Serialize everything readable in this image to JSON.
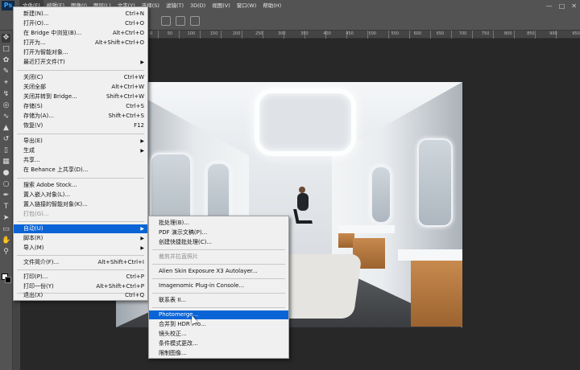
{
  "menubar": {
    "logo": "Ps",
    "items": [
      "文件(F)",
      "编辑(E)",
      "图像(I)",
      "图层(L)",
      "文字(Y)",
      "选择(S)",
      "滤镜(T)",
      "3D(D)",
      "视图(V)",
      "窗口(W)",
      "帮助(H)"
    ]
  },
  "ruler": {
    "numbers": [
      "0",
      "50",
      "100",
      "150",
      "200",
      "250",
      "300",
      "350",
      "400",
      "450",
      "500",
      "550",
      "600",
      "650",
      "700",
      "750",
      "800",
      "850",
      "900",
      "950"
    ]
  },
  "file_menu": {
    "items": [
      {
        "label": "新建(N)...",
        "shortcut": "Ctrl+N"
      },
      {
        "label": "打开(O)...",
        "shortcut": "Ctrl+O"
      },
      {
        "label": "在 Bridge 中浏览(B)...",
        "shortcut": "Alt+Ctrl+O"
      },
      {
        "label": "打开为...",
        "shortcut": "Alt+Shift+Ctrl+O"
      },
      {
        "label": "打开为智能对象...",
        "shortcut": ""
      },
      {
        "label": "最近打开文件(T)",
        "shortcut": "",
        "submenu": true
      },
      {
        "label": "关闭(C)",
        "shortcut": "Ctrl+W"
      },
      {
        "label": "关闭全部",
        "shortcut": "Alt+Ctrl+W"
      },
      {
        "label": "关闭并转到 Bridge...",
        "shortcut": "Shift+Ctrl+W"
      },
      {
        "label": "存储(S)",
        "shortcut": "Ctrl+S"
      },
      {
        "label": "存储为(A)...",
        "shortcut": "Shift+Ctrl+S"
      },
      {
        "label": "恢复(V)",
        "shortcut": "F12"
      },
      {
        "label": "导出(E)",
        "shortcut": "",
        "submenu": true
      },
      {
        "label": "生成",
        "shortcut": "",
        "submenu": true
      },
      {
        "label": "共享...",
        "shortcut": ""
      },
      {
        "label": "在 Behance 上共享(D)...",
        "shortcut": ""
      },
      {
        "label": "搜索 Adobe Stock...",
        "shortcut": ""
      },
      {
        "label": "置入嵌入对象(L)...",
        "shortcut": ""
      },
      {
        "label": "置入链接的智能对象(K)...",
        "shortcut": ""
      },
      {
        "label": "打包(G)...",
        "shortcut": "",
        "disabled": true
      },
      {
        "label": "自动(U)",
        "shortcut": "",
        "submenu": true,
        "highlighted": true
      },
      {
        "label": "脚本(R)",
        "shortcut": "",
        "submenu": true
      },
      {
        "label": "导入(M)",
        "shortcut": "",
        "submenu": true
      },
      {
        "label": "文件简介(F)...",
        "shortcut": "Alt+Shift+Ctrl+I"
      },
      {
        "label": "打印(P)...",
        "shortcut": "Ctrl+P"
      },
      {
        "label": "打印一份(Y)",
        "shortcut": "Alt+Shift+Ctrl+P"
      },
      {
        "label": "退出(X)",
        "shortcut": "Ctrl+Q"
      }
    ]
  },
  "automate_menu": {
    "items": [
      {
        "label": "批处理(B)..."
      },
      {
        "label": "PDF 演示文稿(P)..."
      },
      {
        "label": "创建快捷批处理(C)..."
      },
      {
        "label": "裁剪并拉直照片",
        "disabled": true
      },
      {
        "label": "Alien Skin Exposure X3 Autolayer..."
      },
      {
        "label": "Imagenomic Plug-in Console..."
      },
      {
        "label": "联系表 II..."
      },
      {
        "label": "Photomerge...",
        "highlighted": true
      },
      {
        "label": "合并到 HDR Pro..."
      },
      {
        "label": "镜头校正..."
      },
      {
        "label": "条件模式更改..."
      },
      {
        "label": "限制图像..."
      }
    ]
  },
  "tools": [
    "move-icon",
    "marquee-icon",
    "lasso-icon",
    "quick-select-icon",
    "crop-icon",
    "eyedropper-icon",
    "healing-icon",
    "brush-icon",
    "stamp-icon",
    "history-brush-icon",
    "eraser-icon",
    "gradient-icon",
    "blur-icon",
    "dodge-icon",
    "pen-icon",
    "type-icon",
    "path-select-icon",
    "shape-icon",
    "hand-icon",
    "zoom-icon"
  ],
  "colors": {
    "highlight": "#0a64d6",
    "menu_bg": "#f0f0f0",
    "app_bg": "#282828",
    "panel": "#535353"
  }
}
